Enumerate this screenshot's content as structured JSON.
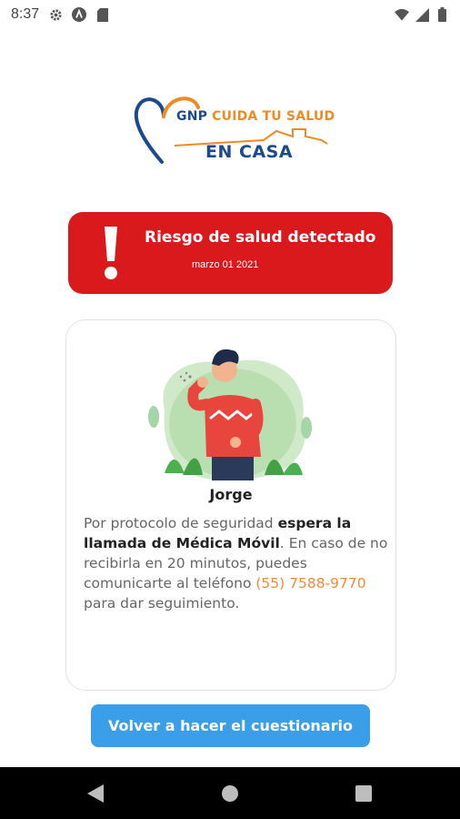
{
  "status_bar": {
    "time": "8:37",
    "left_icons": [
      "gear-icon",
      "a-circle-icon",
      "sd-card-icon"
    ],
    "right_icons": [
      "wifi-icon",
      "signal-icon",
      "battery-icon"
    ]
  },
  "logo": {
    "brand": "GNP",
    "tagline": "CUIDA TU SALUD",
    "subtitle": "EN CASA"
  },
  "alert": {
    "title": "Riesgo de salud detectado",
    "date": "marzo 01 2021",
    "color": "#d9191c"
  },
  "card": {
    "patient_name": "Jorge",
    "message_part1": "Por protocolo de seguridad ",
    "message_bold": "espera la llamada de Médica Móvil",
    "message_part2": ". En caso de no recibirla en 20 minutos, puedes comunicarte al teléfono ",
    "phone": "(55) 7588-9770",
    "message_part3": " para dar seguimiento."
  },
  "actions": {
    "retake_label": "Volver a hacer el cuestionario",
    "color": "#3b9ee8"
  },
  "nav": {
    "buttons": [
      "back-icon",
      "home-icon",
      "recents-icon"
    ]
  }
}
